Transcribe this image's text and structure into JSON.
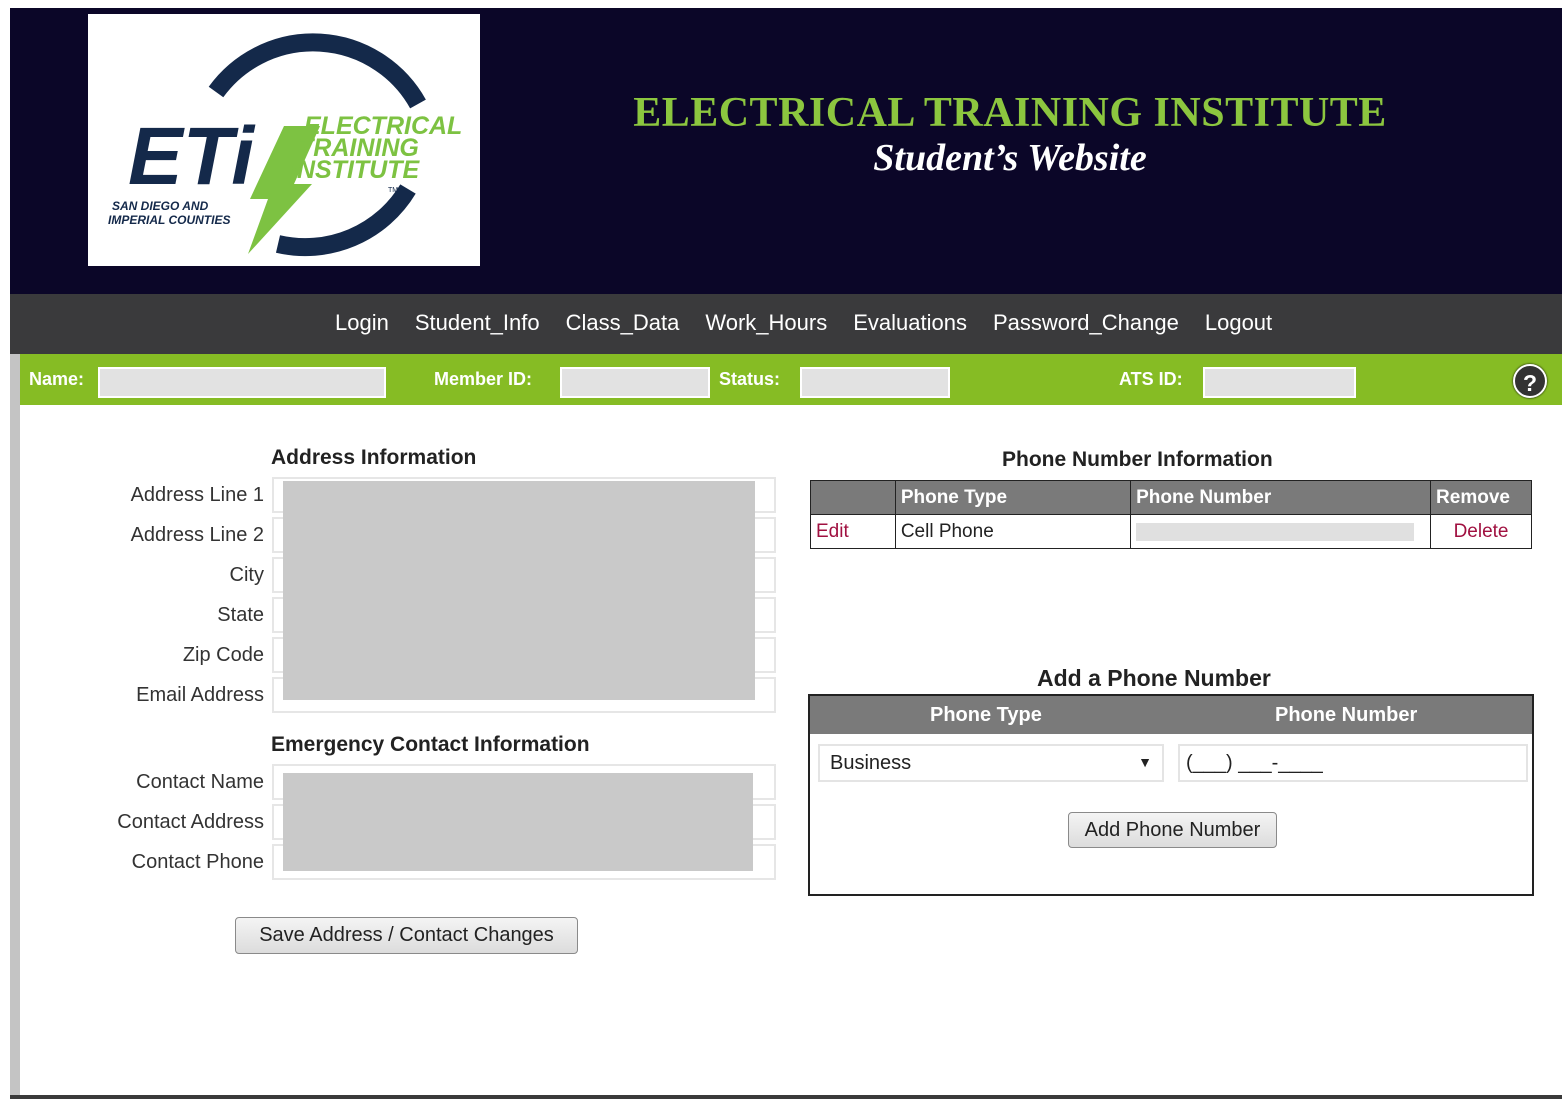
{
  "header": {
    "logo_alt": "ETI Electrical Training Institute - San Diego and Imperial Counties",
    "logo_text": {
      "mark": "ETi",
      "line1": "ELECTRICAL",
      "line2": "TRAINING",
      "line3": "INSTITUTE",
      "tm": "TM",
      "region1": "SAN DIEGO AND",
      "region2": "IMPERIAL COUNTIES"
    },
    "title": "ELECTRICAL TRAINING INSTITUTE",
    "subtitle": "Student’s Website"
  },
  "nav": {
    "items": [
      "Login",
      "Student_Info",
      "Class_Data",
      "Work_Hours",
      "Evaluations",
      "Password_Change",
      "Logout"
    ]
  },
  "student_bar": {
    "name_label": "Name:",
    "member_id_label": "Member ID:",
    "status_label": "Status:",
    "ats_id_label": "ATS ID:",
    "help": "?"
  },
  "address": {
    "title": "Address Information",
    "labels": [
      "Address Line 1",
      "Address Line 2",
      "City",
      "State",
      "Zip Code",
      "Email Address"
    ]
  },
  "emergency": {
    "title": "Emergency Contact Information",
    "labels": [
      "Contact Name",
      "Contact Address",
      "Contact Phone"
    ]
  },
  "save_button": "Save Address / Contact Changes",
  "phone_info": {
    "title": "Phone Number Information",
    "columns": [
      "",
      "Phone Type",
      "Phone Number",
      "Remove"
    ],
    "rows": [
      {
        "edit": "Edit",
        "type": "Cell Phone",
        "delete": "Delete"
      }
    ]
  },
  "add_phone": {
    "title": "Add a Phone Number",
    "col_type": "Phone Type",
    "col_number": "Phone Number",
    "selected_type": "Business",
    "number_mask": "(___) ___-____",
    "button": "Add Phone Number"
  },
  "colors": {
    "header_bg": "#0b0628",
    "nav_bg": "#3a3a3c",
    "accent_green": "#86bc24",
    "title_green": "#8cc63f",
    "logo_navy": "#14294a",
    "link": "#a01040"
  }
}
